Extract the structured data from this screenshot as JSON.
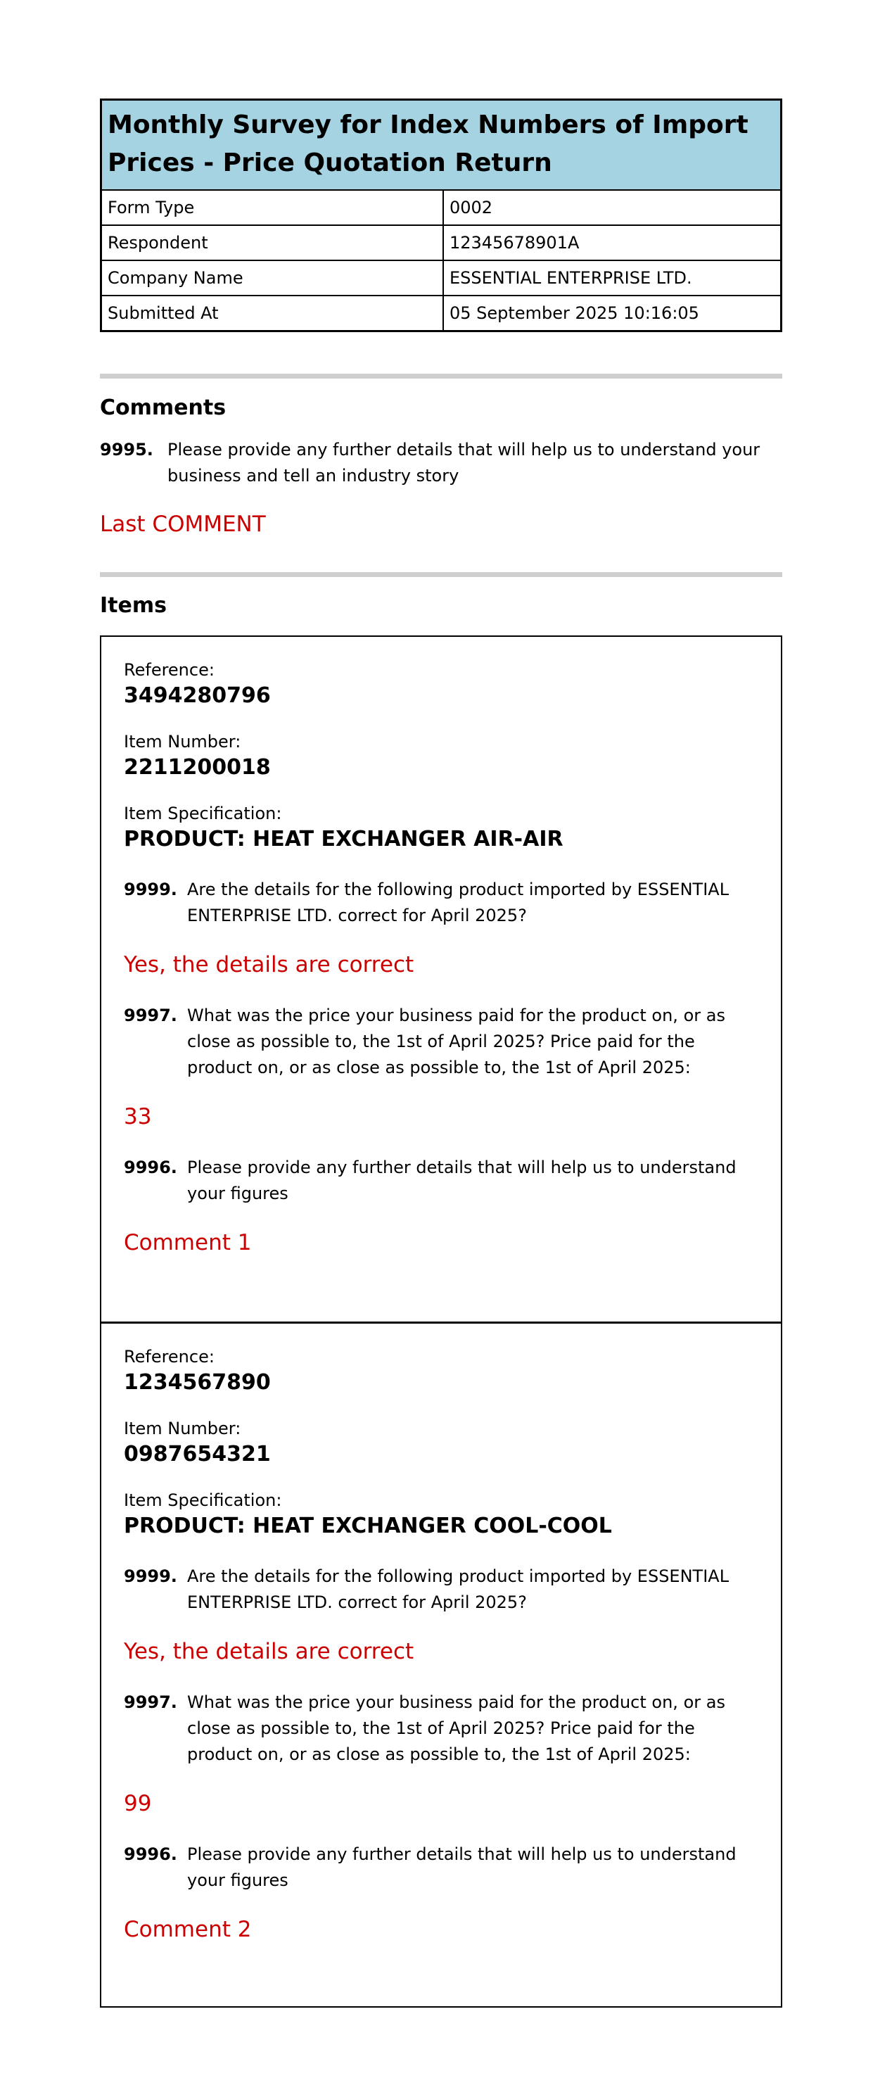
{
  "header": {
    "title": "Monthly Survey for Index Numbers of Import Prices - Price Quotation Return"
  },
  "summary": [
    {
      "key": "Form Type",
      "value": "0002"
    },
    {
      "key": "Respondent",
      "value": "12345678901A"
    },
    {
      "key": "Company Name",
      "value": "ESSENTIAL ENTERPRISE LTD."
    },
    {
      "key": "Submitted At",
      "value": "05 September 2025 10:16:05"
    }
  ],
  "comments": {
    "heading": "Comments",
    "question_number": "9995.",
    "question_text": "Please provide any further details that will help us to understand your business and tell an industry story",
    "answer": "Last COMMENT"
  },
  "items_section": {
    "heading": "Items",
    "items": [
      {
        "reference_label": "Reference:",
        "reference": "3494280796",
        "item_number_label": "Item Number:",
        "item_number": "2211200018",
        "spec_label": "Item Specification:",
        "spec": "PRODUCT: HEAT EXCHANGER AIR-AIR",
        "q1_number": "9999.",
        "q1_text": "Are the details for the following product imported by ESSENTIAL ENTERPRISE LTD. correct for April 2025?",
        "q1_answer": "Yes, the details are correct",
        "q2_number": "9997.",
        "q2_text": "What was the price your business paid for the product on, or as close as possible to, the 1st of April 2025? Price paid for the product on, or as close as possible to, the 1st of April 2025:",
        "q2_answer": "33",
        "q3_number": "9996.",
        "q3_text": "Please provide any further details that will help us to understand your figures",
        "q3_answer": "Comment 1"
      },
      {
        "reference_label": "Reference:",
        "reference": "1234567890",
        "item_number_label": "Item Number:",
        "item_number": "0987654321",
        "spec_label": "Item Specification:",
        "spec": "PRODUCT: HEAT EXCHANGER COOL-COOL",
        "q1_number": "9999.",
        "q1_text": "Are the details for the following product imported by ESSENTIAL ENTERPRISE LTD. correct for April 2025?",
        "q1_answer": "Yes, the details are correct",
        "q2_number": "9997.",
        "q2_text": "What was the price your business paid for the product on, or as close as possible to, the 1st of April 2025? Price paid for the product on, or as close as possible to, the 1st of April 2025:",
        "q2_answer": "99",
        "q3_number": "9996.",
        "q3_text": "Please provide any further details that will help us to understand your figures",
        "q3_answer": "Comment 2"
      }
    ]
  },
  "colors": {
    "header_background": "#a5d3e2",
    "answer_text": "#cc0000",
    "divider": "#cfcfcf"
  }
}
